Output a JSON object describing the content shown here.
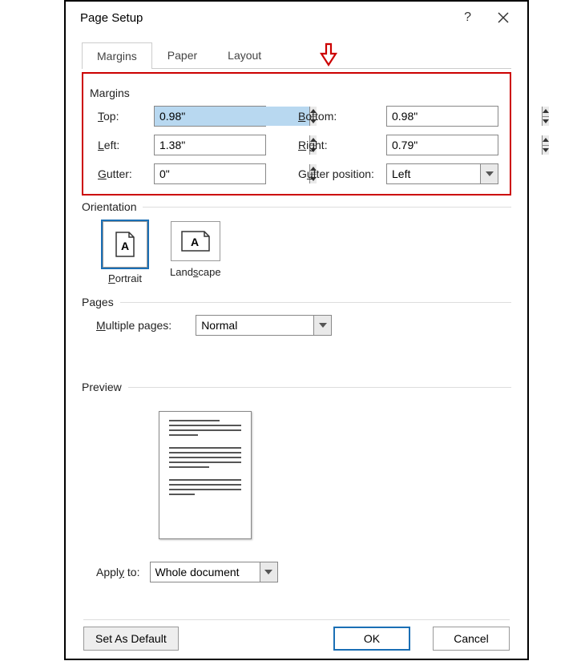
{
  "dialog": {
    "title": "Page Setup"
  },
  "tabs": {
    "margins": "Margins",
    "paper": "Paper",
    "layout": "Layout"
  },
  "sections": {
    "margins": "Margins",
    "orientation": "Orientation",
    "pages": "Pages",
    "preview": "Preview"
  },
  "margins": {
    "top_label": "Top:",
    "top_value": "0.98\"",
    "bottom_label": "Bottom:",
    "bottom_value": "0.98\"",
    "left_label": "Left:",
    "left_value": "1.38\"",
    "right_label": "Right:",
    "right_value": "0.79\"",
    "gutter_label": "Gutter:",
    "gutter_value": "0\"",
    "gutter_pos_label": "Gutter position:",
    "gutter_pos_value": "Left"
  },
  "orientation": {
    "portrait": "Portrait",
    "landscape": "Landscape"
  },
  "pages": {
    "multiple_label": "Multiple pages:",
    "multiple_value": "Normal"
  },
  "apply": {
    "label": "Apply to:",
    "value": "Whole document"
  },
  "buttons": {
    "set_default": "Set As Default",
    "ok": "OK",
    "cancel": "Cancel"
  }
}
